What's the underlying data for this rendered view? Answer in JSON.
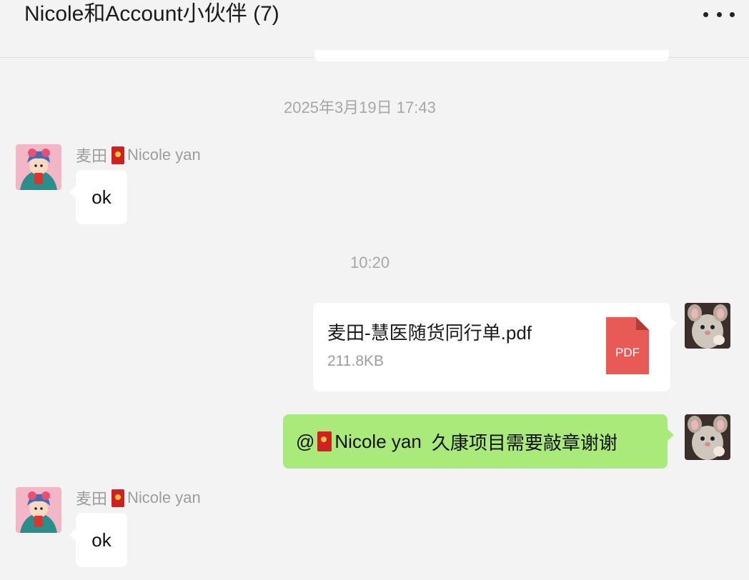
{
  "header": {
    "title": "Nicole和Account小伙伴 (7)",
    "more_icon": "more-icon"
  },
  "messages": {
    "timestamp_1": "2025年3月19日 17:43",
    "msg1": {
      "sender": "麦田",
      "sender_suffix": "Nicole yan",
      "text": "ok"
    },
    "timestamp_2": "10:20",
    "file": {
      "name": "麦田-慧医随货同行单.pdf",
      "size": "211.8KB",
      "badge": "PDF"
    },
    "mention": {
      "at": "@",
      "name": "Nicole yan",
      "text": "久康项目需要敲章谢谢"
    },
    "msg2": {
      "sender": "麦田",
      "sender_suffix": "Nicole yan",
      "text": "ok"
    }
  },
  "colors": {
    "background": "#f3f3f3",
    "bubble_self": "#a9ea7a",
    "bubble_other": "#ffffff",
    "pdf_red": "#e85a55",
    "envelope_red": "#d21f1f"
  }
}
